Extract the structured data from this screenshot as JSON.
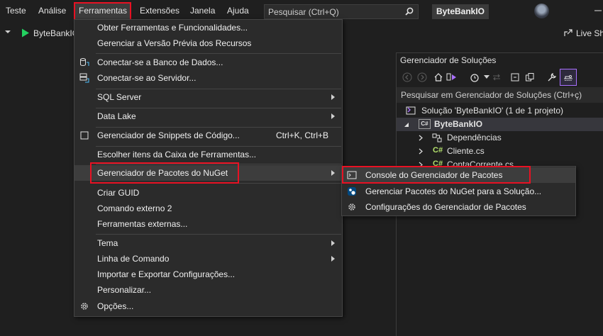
{
  "menubar": {
    "items": [
      "Teste",
      "Análise",
      "Ferramentas",
      "Extensões",
      "Janela",
      "Ajuda"
    ],
    "search_placeholder": "Pesquisar (Ctrl+Q)",
    "solution_title": "ByteBankIO"
  },
  "toolbar": {
    "project": "ByteBankIO",
    "live_share": "Live Sh"
  },
  "tools_menu": {
    "items": [
      {
        "label": "Obter Ferramentas e Funcionalidades...",
        "shortcut": "",
        "submenu": false,
        "icon": ""
      },
      {
        "label": "Gerenciar a Versão Prévia dos Recursos",
        "shortcut": "",
        "submenu": false,
        "icon": ""
      },
      {
        "label": "Conectar-se a Banco de Dados...",
        "shortcut": "",
        "submenu": false,
        "icon": "database-connect-icon"
      },
      {
        "label": "Conectar-se ao Servidor...",
        "shortcut": "",
        "submenu": false,
        "icon": "server-connect-icon"
      },
      {
        "label": "SQL Server",
        "shortcut": "",
        "submenu": true,
        "icon": ""
      },
      {
        "label": "Data Lake",
        "shortcut": "",
        "submenu": true,
        "icon": ""
      },
      {
        "label": "Gerenciador de Snippets de Código...",
        "shortcut": "Ctrl+K, Ctrl+B",
        "submenu": false,
        "icon": "snippet-icon"
      },
      {
        "label": "Escolher itens da Caixa de Ferramentas...",
        "shortcut": "",
        "submenu": false,
        "icon": ""
      },
      {
        "label": "Gerenciador de Pacotes do NuGet",
        "shortcut": "",
        "submenu": true,
        "icon": ""
      },
      {
        "label": "Criar GUID",
        "shortcut": "",
        "submenu": false,
        "icon": ""
      },
      {
        "label": "Comando externo 2",
        "shortcut": "",
        "submenu": false,
        "icon": ""
      },
      {
        "label": "Ferramentas externas...",
        "shortcut": "",
        "submenu": false,
        "icon": ""
      },
      {
        "label": "Tema",
        "shortcut": "",
        "submenu": true,
        "icon": ""
      },
      {
        "label": "Linha de Comando",
        "shortcut": "",
        "submenu": true,
        "icon": ""
      },
      {
        "label": "Importar e Exportar Configurações...",
        "shortcut": "",
        "submenu": false,
        "icon": ""
      },
      {
        "label": "Personalizar...",
        "shortcut": "",
        "submenu": false,
        "icon": ""
      },
      {
        "label": "Opções...",
        "shortcut": "",
        "submenu": false,
        "icon": "gear-icon"
      }
    ]
  },
  "nuget_submenu": {
    "items": [
      {
        "label": "Console do Gerenciador de Pacotes",
        "icon": "console-icon"
      },
      {
        "label": "Gerenciar Pacotes do NuGet para a Solução...",
        "icon": "nuget-icon"
      },
      {
        "label": "Configurações do Gerenciador de Pacotes",
        "icon": "gear-icon"
      }
    ]
  },
  "solution_explorer": {
    "title": "Gerenciador de Soluções",
    "search_placeholder": "Pesquisar em Gerenciador de Soluções (Ctrl+ç)",
    "solution": "Solução 'ByteBankIO' (1 de 1 projeto)",
    "project": "ByteBankIO",
    "dependencies": "Dependências",
    "files": [
      "Cliente.cs",
      "ContaCorrente.cs"
    ],
    "csharp_badge": "C#"
  },
  "colors": {
    "background": "#1f1f1f",
    "menu_bg": "#2b2b2b",
    "highlight_box": "#e81123",
    "accent_purple": "#a970ff",
    "play_green": "#23d160"
  }
}
